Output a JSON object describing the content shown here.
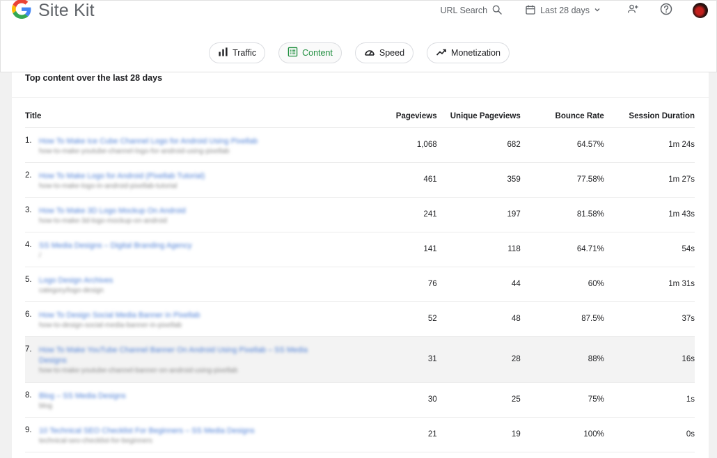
{
  "header": {
    "brand": "Site Kit",
    "url_search_label": "URL Search",
    "date_range_label": "Last 28 days"
  },
  "tabs": [
    {
      "label": "Traffic",
      "icon": "bar-chart-icon",
      "active": false
    },
    {
      "label": "Content",
      "icon": "content-icon",
      "active": true
    },
    {
      "label": "Speed",
      "icon": "speedometer-icon",
      "active": false
    },
    {
      "label": "Monetization",
      "icon": "trending-up-icon",
      "active": false
    }
  ],
  "colors": {
    "accent": "#1e8e3e",
    "link": "#4d7fd6"
  },
  "card": {
    "title": "Top content over the last 28 days",
    "columns": [
      "Title",
      "Pageviews",
      "Unique Pageviews",
      "Bounce Rate",
      "Session Duration"
    ],
    "rows": [
      {
        "rank": "1.",
        "title": "How To Make Ice Cube Channel Logo for Android Using Pixellab",
        "url": "how-to-make-youtube-channel-logo-for-android-using-pixellab",
        "pageviews": "1,068",
        "unique": "682",
        "bounce": "64.57%",
        "duration": "1m 24s"
      },
      {
        "rank": "2.",
        "title": "How To Make Logo for Android (Pixellab Tutorial)",
        "url": "how-to-make-logo-in-android-pixellab-tutorial",
        "pageviews": "461",
        "unique": "359",
        "bounce": "77.58%",
        "duration": "1m 27s"
      },
      {
        "rank": "3.",
        "title": "How To Make 3D Logo Mockup On Android",
        "url": "how-to-make-3d-logo-mockup-on-android",
        "pageviews": "241",
        "unique": "197",
        "bounce": "81.58%",
        "duration": "1m 43s"
      },
      {
        "rank": "4.",
        "title": "SS Media Designs – Digital Branding Agency",
        "url": "/",
        "pageviews": "141",
        "unique": "118",
        "bounce": "64.71%",
        "duration": "54s"
      },
      {
        "rank": "5.",
        "title": "Logo Design Archives",
        "url": "category/logo-design",
        "pageviews": "76",
        "unique": "44",
        "bounce": "60%",
        "duration": "1m 31s"
      },
      {
        "rank": "6.",
        "title": "How To Design Social Media Banner in Pixellab",
        "url": "how-to-design-social-media-banner-in-pixellab",
        "pageviews": "52",
        "unique": "48",
        "bounce": "87.5%",
        "duration": "37s"
      },
      {
        "rank": "7.",
        "title": "How To Make YouTube Channel Banner On Android Using Pixellab – SS Media Designs",
        "url": "how-to-make-youtube-channel-banner-on-android-using-pixellab",
        "pageviews": "31",
        "unique": "28",
        "bounce": "88%",
        "duration": "16s"
      },
      {
        "rank": "8.",
        "title": "Blog – SS Media Designs",
        "url": "blog",
        "pageviews": "30",
        "unique": "25",
        "bounce": "75%",
        "duration": "1s"
      },
      {
        "rank": "9.",
        "title": "10 Technical SEO Checklist For Beginners – SS Media Designs",
        "url": "technical-seo-checklist-for-beginners",
        "pageviews": "21",
        "unique": "19",
        "bounce": "100%",
        "duration": "0s"
      }
    ]
  }
}
